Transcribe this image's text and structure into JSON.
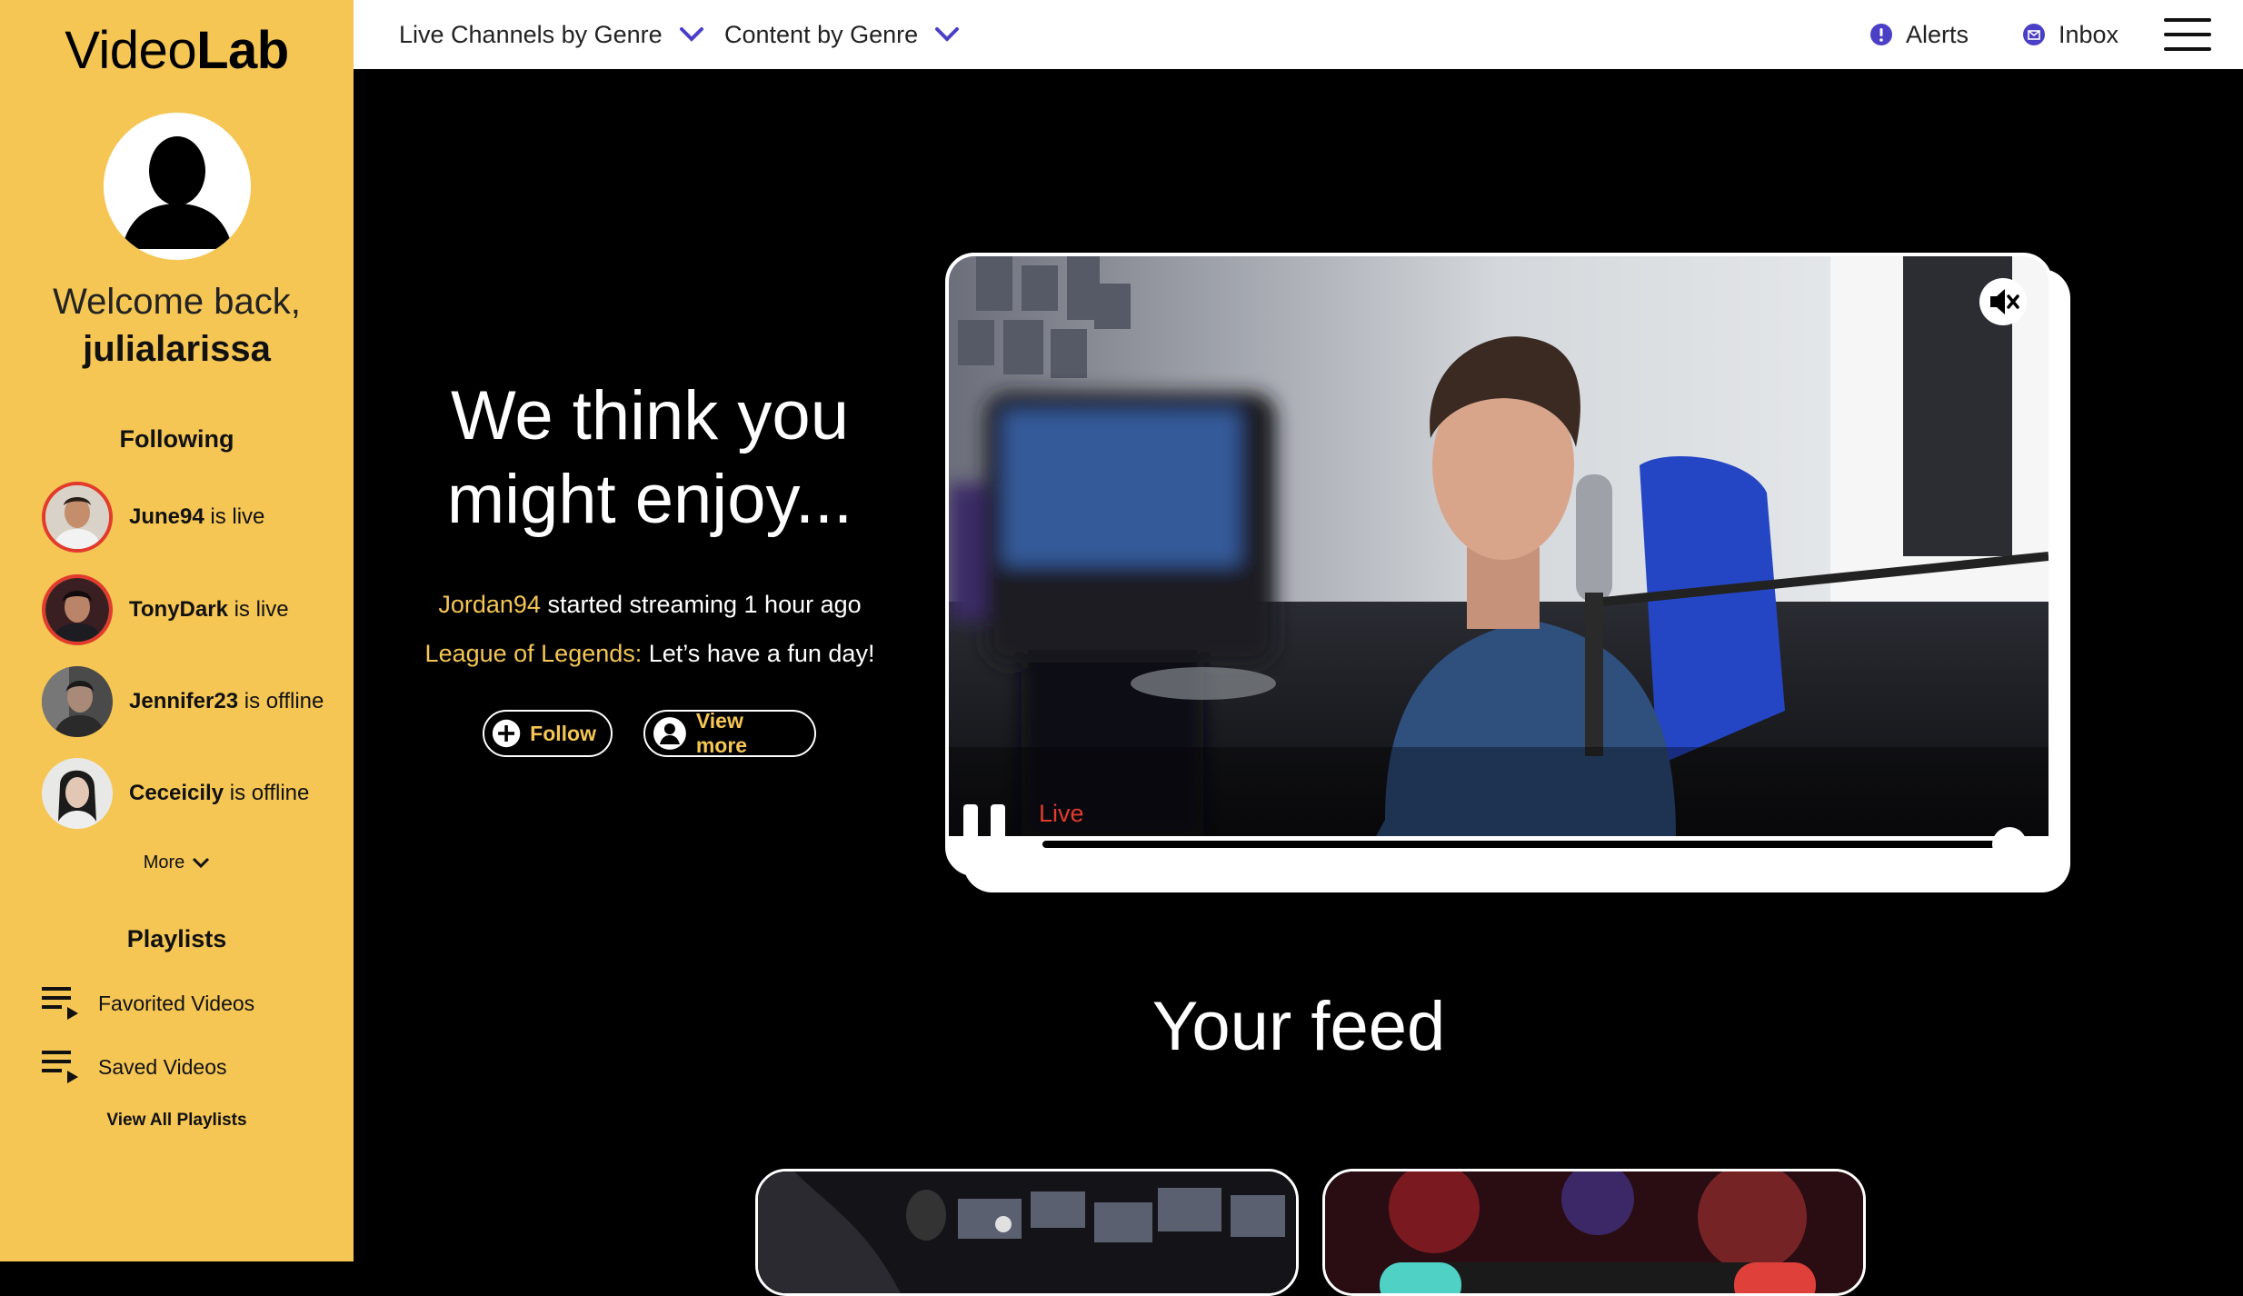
{
  "app": {
    "logo_light": "Video",
    "logo_bold": "Lab"
  },
  "sidebar": {
    "welcome": "Welcome back,",
    "username": "julialarissa",
    "following_heading": "Following",
    "following": [
      {
        "name": "June94",
        "status": " is live",
        "live": true
      },
      {
        "name": "TonyDark",
        "status": " is live",
        "live": true
      },
      {
        "name": "Jennifer23",
        "status": " is offline",
        "live": false
      },
      {
        "name": "Ceceicily",
        "status": " is offline",
        "live": false
      }
    ],
    "more_label": "More",
    "playlists_heading": "Playlists",
    "playlists": [
      {
        "label": "Favorited Videos"
      },
      {
        "label": "Saved Videos"
      }
    ],
    "view_all_label": "View All Playlists"
  },
  "topbar": {
    "nav_live": "Live Channels by Genre",
    "nav_content": "Content by Genre",
    "alerts": "Alerts",
    "inbox": "Inbox"
  },
  "hero": {
    "title_line1": "We think you",
    "title_line2": "might enjoy...",
    "streamer": "Jordan94",
    "stream_text": " started streaming 1 hour ago",
    "game": "League of Legends:",
    "game_text": " Let’s have a fun day!",
    "follow_label": "Follow",
    "view_more_label": "View more"
  },
  "player": {
    "live_label": "Live",
    "progress": 1.0
  },
  "feed": {
    "title": "Your feed"
  },
  "colors": {
    "accent": "#F5C654",
    "live": "#E23B2E",
    "nav_chevron": "#4B3FC6"
  },
  "icons": {
    "nav_chevron": "chevron-down-icon",
    "alerts": "alert-icon",
    "inbox": "mail-icon",
    "menu": "hamburger-icon",
    "follow": "plus-circle-icon",
    "view_more": "user-circle-icon",
    "mute": "mute-icon",
    "pause": "pause-icon",
    "playlist": "playlist-icon"
  }
}
